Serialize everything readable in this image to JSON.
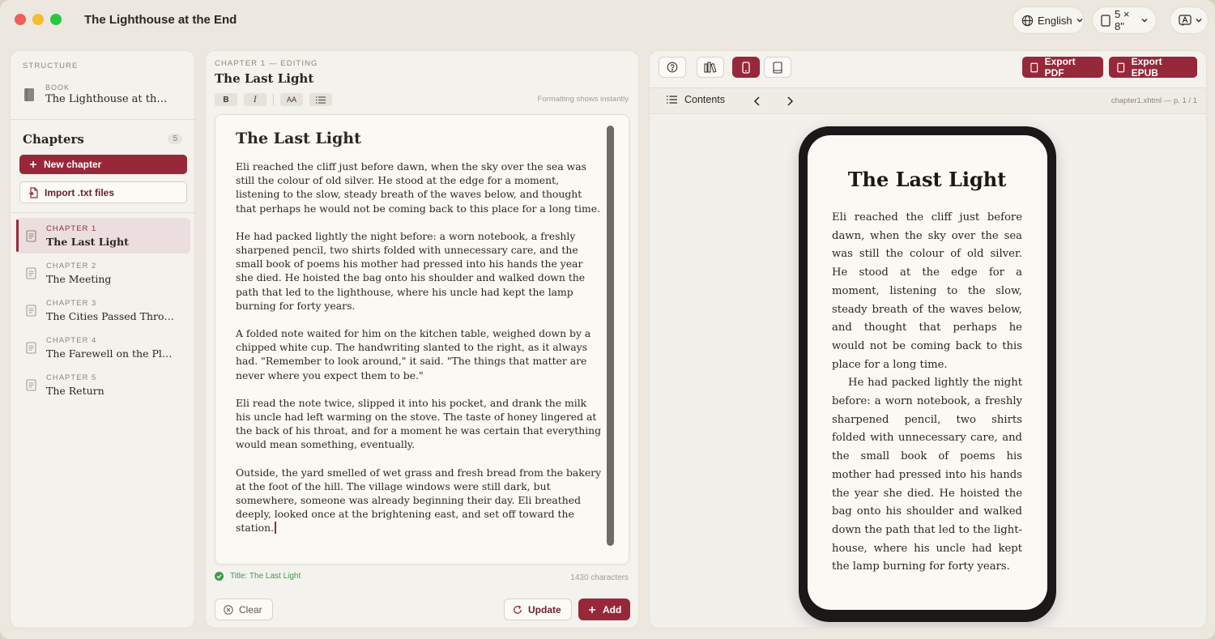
{
  "window": {
    "title": "The Lighthouse at the End"
  },
  "toolbar": {
    "language": "English",
    "page_size": "5 × 8\""
  },
  "sidebar": {
    "structure_label": "STRUCTURE",
    "book_label": "BOOK",
    "book_title": "The Lighthouse at the E...",
    "chapters_heading": "Chapters",
    "chapter_count": "5",
    "new_chapter_label": "New chapter",
    "import_label": "Import .txt files",
    "chapters": [
      {
        "label": "CHAPTER 1",
        "title": "The Last Light"
      },
      {
        "label": "CHAPTER 2",
        "title": "The Meeting"
      },
      {
        "label": "CHAPTER 3",
        "title": "The Cities Passed Throu..."
      },
      {
        "label": "CHAPTER 4",
        "title": "The Farewell on the Platf..."
      },
      {
        "label": "CHAPTER 5",
        "title": "The Return"
      }
    ]
  },
  "editor": {
    "mode_label": "CHAPTER 1 — EDITING",
    "chapter_title": "The Last Light",
    "tools": {
      "bold": "B",
      "italic": "I",
      "size": "AA"
    },
    "hint": "Formatting shows instantly",
    "heading": "The Last Light",
    "paragraphs": [
      "Eli reached the cliff just before dawn, when the sky over the sea was still the colour of old silver. He stood at the edge for a moment, listening to the slow, steady breath of the waves below, and thought that perhaps he would not be coming back to this place for a long time.",
      "He had packed lightly the night before: a worn notebook, a freshly sharpened pencil, two shirts folded with unnecessary care, and the small book of poems his mother had pressed into his hands the year she died. He hoisted the bag onto his shoulder and walked down the path that led to the lighthouse, where his uncle had kept the lamp burning for forty years.",
      "A folded note waited for him on the kitchen table, weighed down by a chipped white cup. The handwriting slanted to the right, as it always had. \"Remember to look around,\" it said. \"The things that matter are never where you expect them to be.\"",
      "Eli read the note twice, slipped it into his pocket, and drank the milk his uncle had left warming on the stove. The taste of honey lingered at the back of his throat, and for a moment he was certain that everything would mean something, eventually.",
      "Outside, the yard smelled of wet grass and fresh bread from the bakery at the foot of the hill. The village windows were still dark, but somewhere, someone was already beginning their day. Eli breathed deeply, looked once at the brightening east, and set off toward the station."
    ],
    "status": "Title: The Last Light",
    "char_count": "1430 characters",
    "clear_label": "Clear",
    "update_label": "Update",
    "add_label": "Add"
  },
  "preview": {
    "export_pdf": "Export PDF",
    "export_epub": "Export EPUB",
    "contents_label": "Contents",
    "file_info": "chapter1.xhtml — p. 1 / 1",
    "heading": "The Last Light",
    "paragraphs": [
      "Eli reached the cliff just before dawn, when the sky over the sea was still the colour of old silver. He stood at the edge for a moment, listening to the slow, steady breath of the waves below, and thought that perhaps he would not be com­ing back to this place for a long time.",
      "He had packed lightly the night before: a worn notebook, a freshly sharpened pencil, two shirts folded with unnecessary care, and the small book of poems his mother had pressed into his hands the year she died. He hoisted the bag onto his shoulder and walked down the path that led to the light­house, where his uncle had kept the lamp burning for forty years."
    ]
  },
  "colors": {
    "accent": "#97283a",
    "success": "#3b9a4e"
  }
}
